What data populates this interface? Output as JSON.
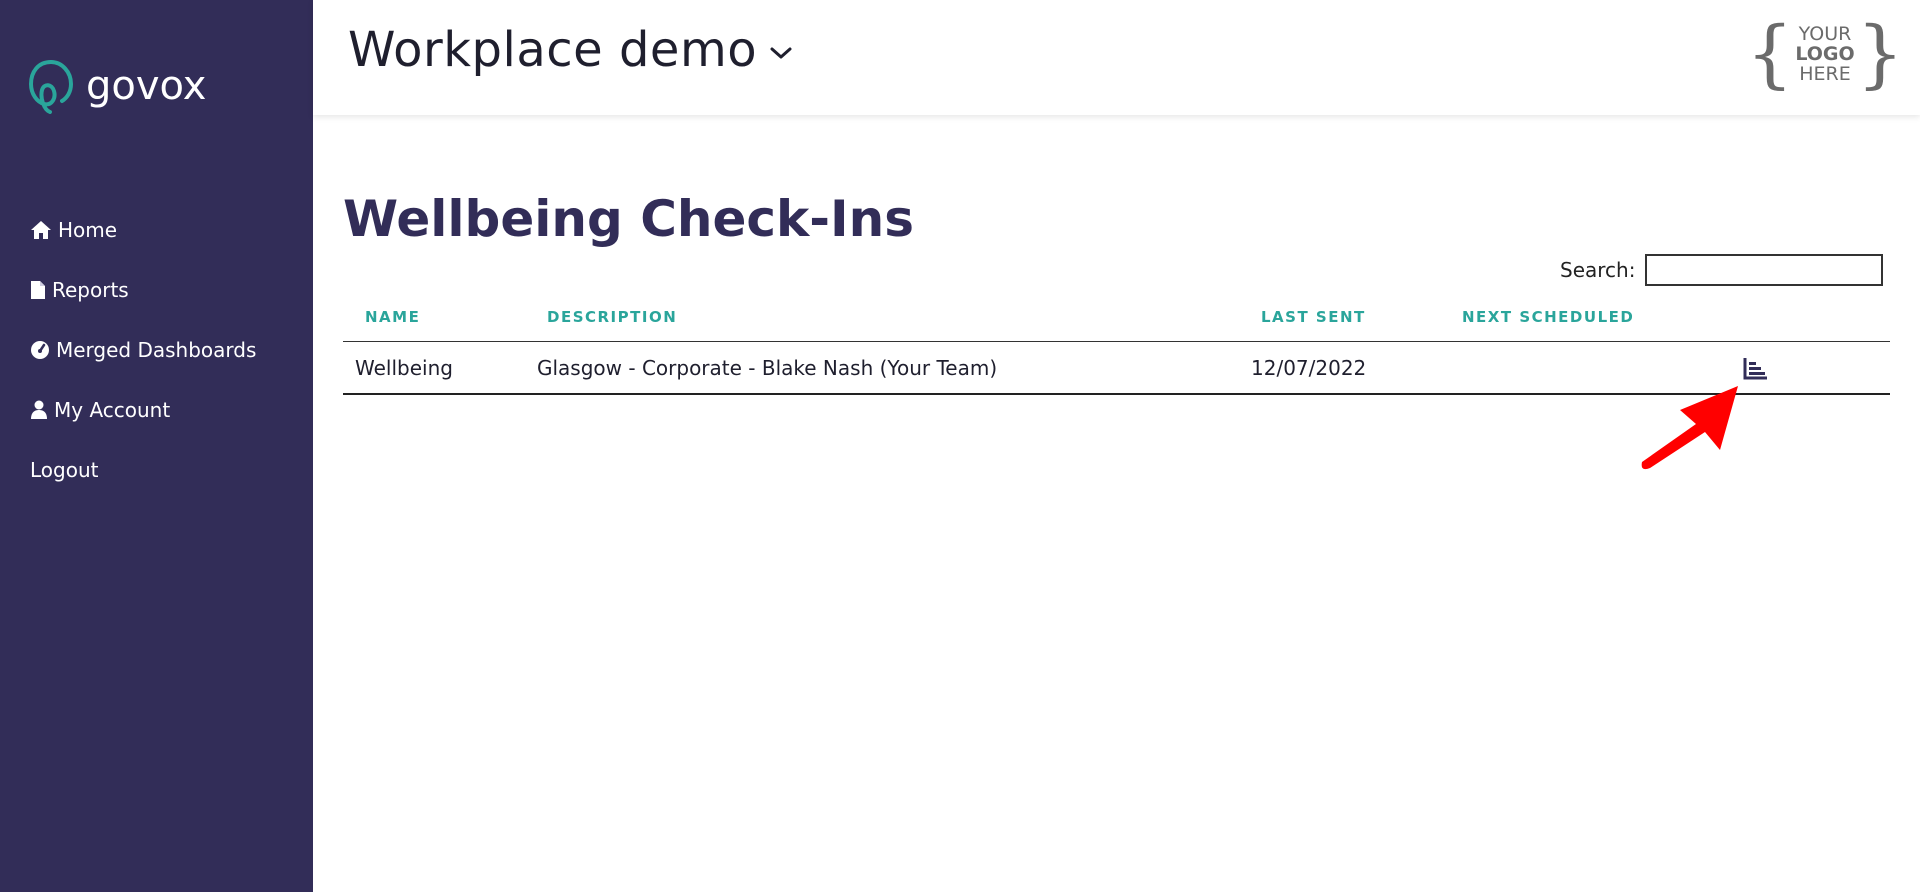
{
  "sidebar": {
    "brand": "govox",
    "items": [
      {
        "label": "Home",
        "icon": "home-icon"
      },
      {
        "label": "Reports",
        "icon": "file-icon"
      },
      {
        "label": "Merged Dashboards",
        "icon": "gauge-icon"
      },
      {
        "label": "My Account",
        "icon": "user-icon"
      },
      {
        "label": "Logout",
        "icon": ""
      }
    ]
  },
  "header": {
    "workspace": "Workplace demo",
    "logo": {
      "line1": "YOUR",
      "line2": "LOGO",
      "line3": "HERE"
    }
  },
  "main": {
    "title": "Wellbeing Check-Ins",
    "search_label": "Search:",
    "search_value": "",
    "columns": [
      "NAME",
      "DESCRIPTION",
      "LAST SENT",
      "NEXT SCHEDULED"
    ],
    "rows": [
      {
        "name": "Wellbeing",
        "description": "Glasgow - Corporate - Blake Nash (Your Team)",
        "last_sent": "12/07/2022",
        "next_scheduled": ""
      }
    ]
  },
  "colors": {
    "sidebar": "#322d58",
    "accent": "#2aa59b",
    "arrow": "#ff0000"
  }
}
